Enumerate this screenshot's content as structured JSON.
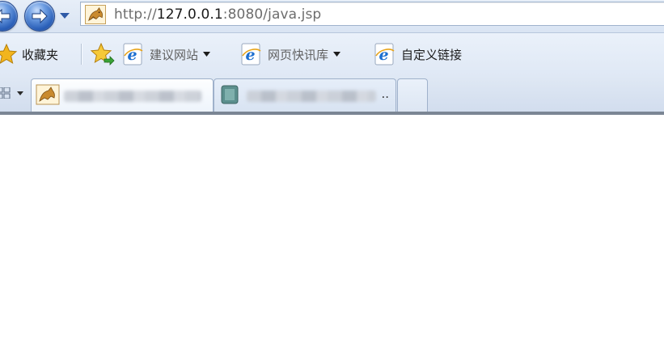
{
  "address_bar": {
    "url_prefix": "http://",
    "url_host": "127.0.0.1",
    "url_rest": ":8080/java.jsp"
  },
  "favorites_bar": {
    "favorites_label": "收藏夹",
    "items": [
      {
        "label": "建议网站",
        "has_dropdown": true
      },
      {
        "label": "网页快讯库",
        "has_dropdown": true
      },
      {
        "label": "自定义链接",
        "has_dropdown": false
      }
    ]
  },
  "tabs": {
    "active_tab_suffix": "",
    "inactive_tab_suffix": ".."
  },
  "icons": {
    "back": "back-arrow-icon",
    "forward": "forward-arrow-icon",
    "favorites": "star-icon",
    "add_favorite": "add-favorite-star-icon",
    "site": "tomcat-favicon-icon",
    "ie": "ie-logo-icon"
  },
  "colors": {
    "toolbar": "#dfe8f5",
    "nav_button": "#2a5fb8",
    "ie_blue": "#1d6fd0",
    "star": "#f2b51d"
  }
}
